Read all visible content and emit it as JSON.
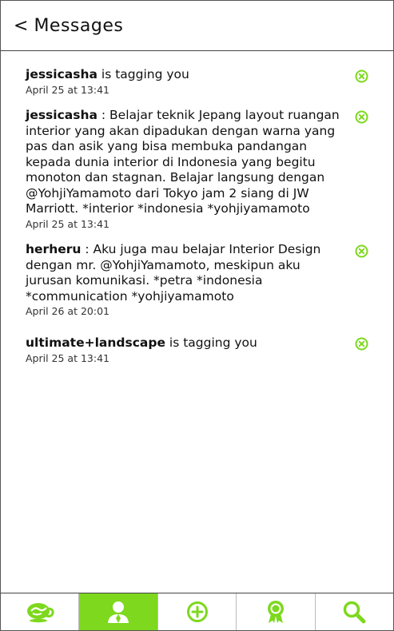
{
  "header": {
    "back_glyph": "<",
    "title": "Messages"
  },
  "colors": {
    "accent": "#7dd81e",
    "text": "#111111"
  },
  "messages": [
    {
      "user": "jessicasha",
      "text": " is tagging you",
      "time": "April 25 at 13:41"
    },
    {
      "user": "jessicasha",
      "text": " : Belajar teknik Jepang layout ruangan interior yang akan dipadukan dengan warna yang pas dan asik yang bisa membuka pandangan kepada dunia interior di Indonesia yang begitu monoton dan stagnan. Belajar langsung dengan @YohjiYamamoto dari Tokyo jam 2 siang di JW Marriott. *interior *indonesia *yohjiyamamoto",
      "time": "April 25 at 13:41"
    },
    {
      "user": "herheru",
      "text": " : Aku juga mau belajar Interior Design dengan mr. @YohjiYamamoto, meskipun aku jurusan komunikasi. *petra *indonesia *communication *yohjiyamamoto",
      "time": "April 26 at 20:01"
    },
    {
      "user": "ultimate+landscape",
      "text": " is tagging you",
      "time": "April 25 at 13:41"
    }
  ],
  "tabs": [
    {
      "icon": "coffee-cup-icon",
      "active": false
    },
    {
      "icon": "profile-person-icon",
      "active": true
    },
    {
      "icon": "add-circle-icon",
      "active": false
    },
    {
      "icon": "award-ribbon-icon",
      "active": false
    },
    {
      "icon": "search-icon",
      "active": false
    }
  ]
}
